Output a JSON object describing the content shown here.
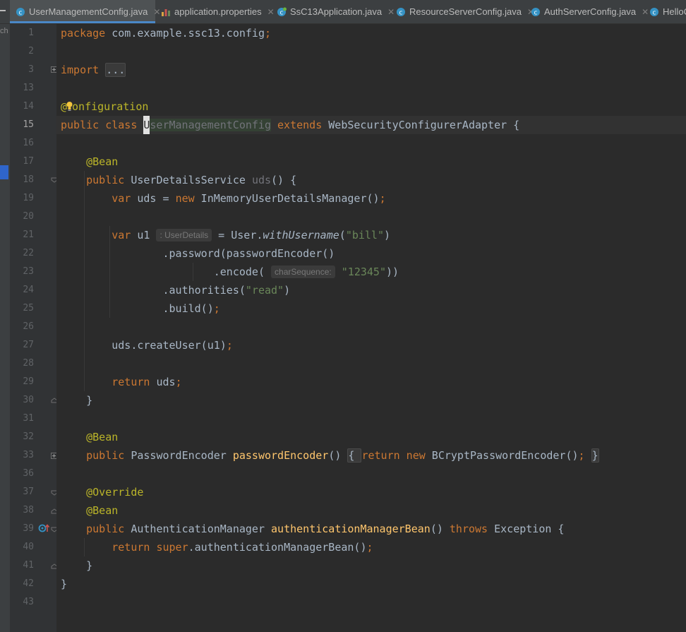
{
  "tabs": [
    {
      "label": "UserManagementConfig.java",
      "icon": "java-class-icon",
      "active": true,
      "closable": true
    },
    {
      "label": "application.properties",
      "icon": "properties-file-icon",
      "active": false,
      "closable": true
    },
    {
      "label": "SsC13Application.java",
      "icon": "spring-boot-class-icon",
      "active": false,
      "closable": true
    },
    {
      "label": "ResourceServerConfig.java",
      "icon": "java-class-icon",
      "active": false,
      "closable": true
    },
    {
      "label": "AuthServerConfig.java",
      "icon": "java-class-icon",
      "active": false,
      "closable": true
    },
    {
      "label": "HelloC",
      "icon": "java-class-icon",
      "active": false,
      "closable": false
    }
  ],
  "left_strip_label": "ch",
  "editor": {
    "current_line": 15,
    "lines": [
      {
        "n": 1,
        "t": "package com.example.ssc13.config;"
      },
      {
        "n": 2,
        "t": ""
      },
      {
        "n": 3,
        "t": "import ..."
      },
      {
        "n": 13,
        "t": ""
      },
      {
        "n": 14,
        "t": "@Configuration"
      },
      {
        "n": 15,
        "t": "public class UserManagementConfig extends WebSecurityConfigurerAdapter {"
      },
      {
        "n": 16,
        "t": ""
      },
      {
        "n": 17,
        "t": "    @Bean"
      },
      {
        "n": 18,
        "t": "    public UserDetailsService uds() {"
      },
      {
        "n": 19,
        "t": "        var uds = new InMemoryUserDetailsManager();"
      },
      {
        "n": 20,
        "t": ""
      },
      {
        "n": 21,
        "t": "        var u1 = User.withUsername(\"bill\")"
      },
      {
        "n": 22,
        "t": "                .password(passwordEncoder()"
      },
      {
        "n": 23,
        "t": "                        .encode(\"12345\"))"
      },
      {
        "n": 24,
        "t": "                .authorities(\"read\")"
      },
      {
        "n": 25,
        "t": "                .build();"
      },
      {
        "n": 26,
        "t": ""
      },
      {
        "n": 27,
        "t": "        uds.createUser(u1);"
      },
      {
        "n": 28,
        "t": ""
      },
      {
        "n": 29,
        "t": "        return uds;"
      },
      {
        "n": 30,
        "t": "    }"
      },
      {
        "n": 31,
        "t": ""
      },
      {
        "n": 32,
        "t": "    @Bean"
      },
      {
        "n": 33,
        "t": "    public PasswordEncoder passwordEncoder() { return new BCryptPasswordEncoder(); }"
      },
      {
        "n": 36,
        "t": ""
      },
      {
        "n": 37,
        "t": "    @Override"
      },
      {
        "n": 38,
        "t": "    @Bean"
      },
      {
        "n": 39,
        "t": "    public AuthenticationManager authenticationManagerBean() throws Exception {"
      },
      {
        "n": 40,
        "t": "        return super.authenticationManagerBean();"
      },
      {
        "n": 41,
        "t": "    }"
      },
      {
        "n": 42,
        "t": "}"
      },
      {
        "n": 43,
        "t": ""
      }
    ],
    "hints": {
      "type_hint": ": UserDetails",
      "param_hint": "charSequence:"
    }
  }
}
